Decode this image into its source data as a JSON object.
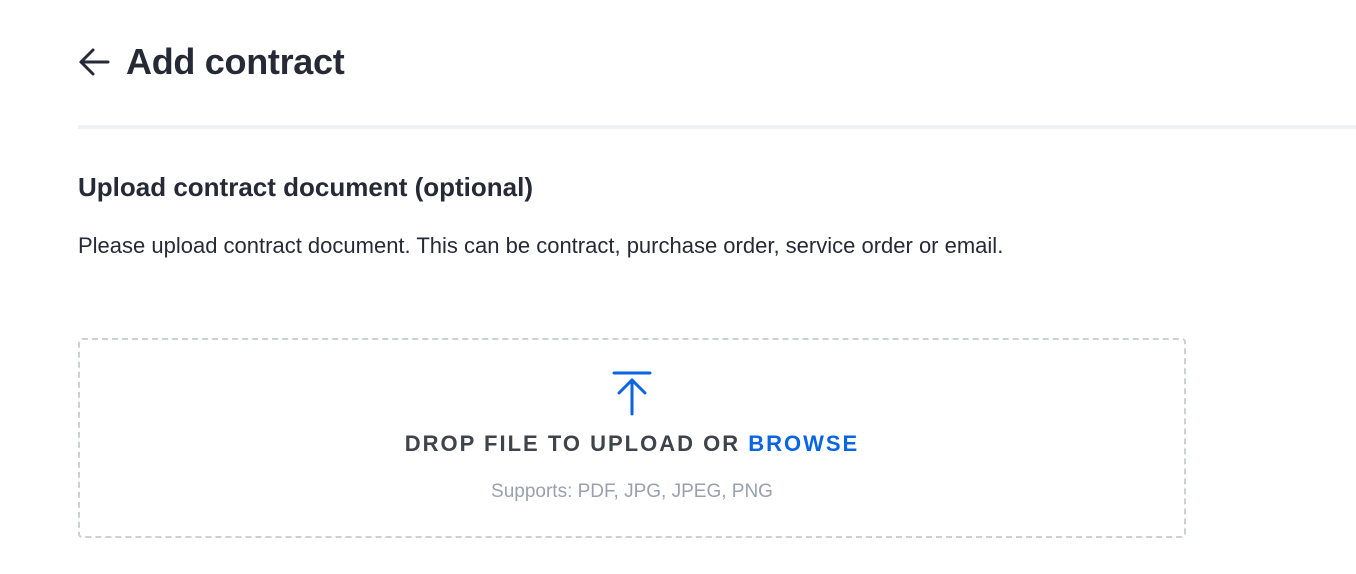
{
  "header": {
    "title": "Add contract",
    "back_icon": "arrow-left-icon"
  },
  "upload_section": {
    "title": "Upload contract document (optional)",
    "description": "Please upload contract document. This can be contract, purchase order, service order or email."
  },
  "dropzone": {
    "icon": "upload-arrow-icon",
    "drop_label": "DROP FILE TO UPLOAD OR",
    "browse_label": "BROWSE",
    "supports": "Supports: PDF, JPG, JPEG, PNG"
  },
  "colors": {
    "accent": "#0a66e0",
    "text": "#262a36",
    "muted": "#9aa0ad",
    "border": "#cdd0d7"
  }
}
